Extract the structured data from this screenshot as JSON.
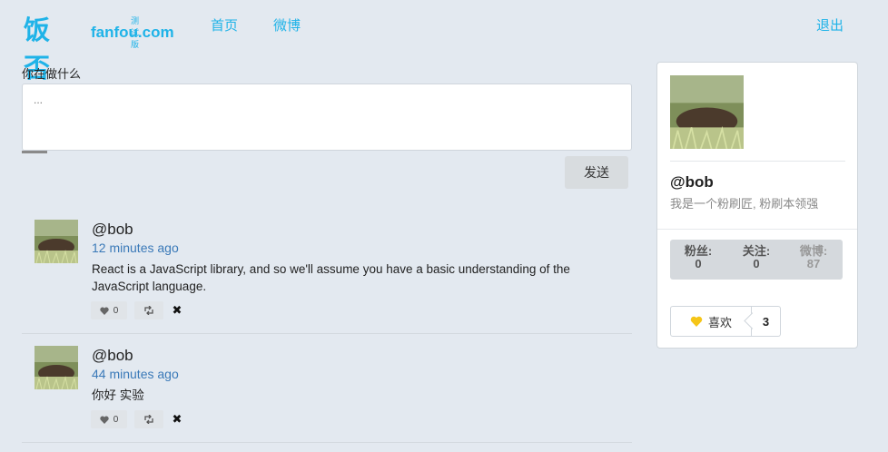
{
  "header": {
    "logo_cn": "饭否",
    "logo_en": "fanfou.com",
    "logo_beta": "测试版",
    "nav": [
      "首页",
      "微博"
    ],
    "logout": "退出"
  },
  "composer": {
    "prompt": "你在做什么",
    "placeholder": "...",
    "send_label": "发送"
  },
  "timeline": [
    {
      "name": "@bob",
      "time": "12 minutes ago",
      "text": "React is a JavaScript library, and so we'll assume you have a basic understanding of the JavaScript language.",
      "likes": "0",
      "reposts": ""
    },
    {
      "name": "@bob",
      "time": "44 minutes ago",
      "text": "你好 实验",
      "likes": "0",
      "reposts": ""
    }
  ],
  "profile": {
    "name": "@bob",
    "bio": "我是一个粉刷匠, 粉刷本领强",
    "stats": [
      {
        "label": "粉丝:",
        "value": "0"
      },
      {
        "label": "关注:",
        "value": "0"
      },
      {
        "label": "微博:",
        "value": "87"
      }
    ],
    "like_label": "喜欢",
    "like_count": "3"
  },
  "colors": {
    "accent": "#1fb3e8",
    "link": "#3a79b8",
    "background": "#e3e9f0",
    "heart": "#f5c518"
  }
}
